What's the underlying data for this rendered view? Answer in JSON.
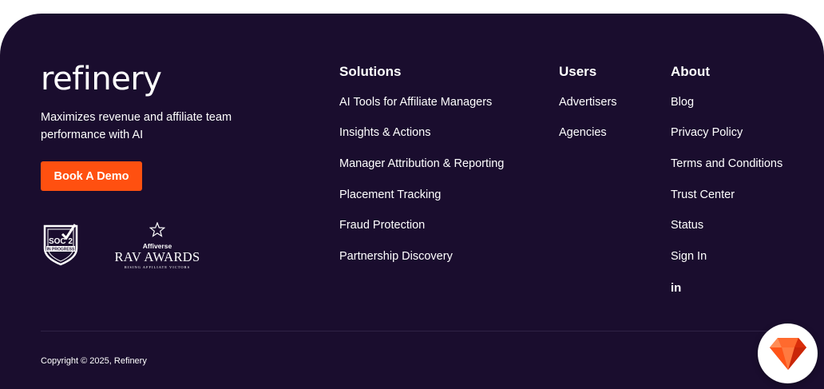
{
  "brand": {
    "logo": "refinery",
    "tagline": "Maximizes revenue and affiliate team performance with AI"
  },
  "cta": {
    "label": "Book A Demo"
  },
  "badges": {
    "soc_line1": "SOC 2",
    "soc_line2": "IN PROGRESS",
    "rav_brand": "Affiverse",
    "rav_title": "RAV AWARDS",
    "rav_sub": "RISING AFFILIATE VICTORS"
  },
  "columns": {
    "solutions": {
      "heading": "Solutions",
      "items": [
        "AI Tools for Affiliate Managers",
        "Insights & Actions",
        "Manager Attribution & Reporting",
        "Placement Tracking",
        "Fraud Protection",
        "Partnership Discovery"
      ]
    },
    "users": {
      "heading": "Users",
      "items": [
        "Advertisers",
        "Agencies"
      ]
    },
    "about": {
      "heading": "About",
      "items": [
        "Blog",
        "Privacy Policy",
        "Terms and Conditions",
        "Trust Center",
        "Status",
        "Sign In"
      ]
    }
  },
  "social": {
    "linkedin": "in"
  },
  "footer": {
    "copyright": "Copyright © 2025, Refinery"
  },
  "colors": {
    "background": "#1a0d2e",
    "accent": "#ff5010"
  },
  "icons": {
    "badge": "ruby-gem-icon",
    "social": "linkedin-icon"
  }
}
